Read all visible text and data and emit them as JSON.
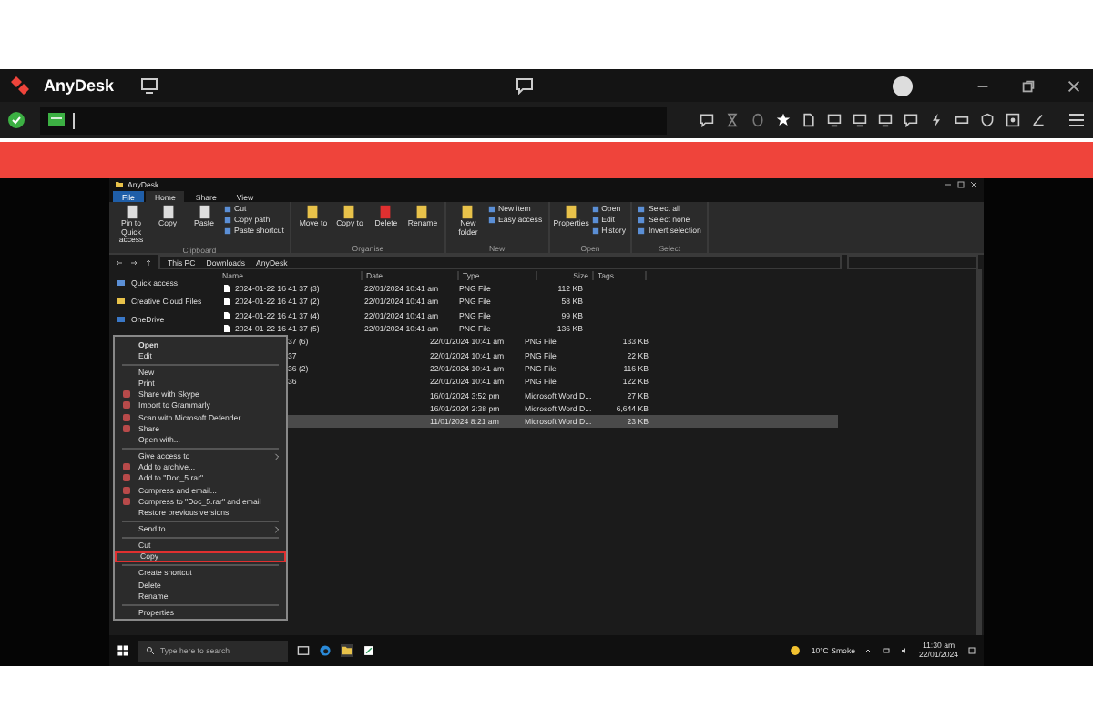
{
  "app": {
    "title": "AnyDesk"
  },
  "explorer": {
    "title": "AnyDesk",
    "ribbon_tabs": [
      {
        "label": "File",
        "selected": false
      },
      {
        "label": "Home",
        "selected": true
      },
      {
        "label": "Share",
        "selected": false
      },
      {
        "label": "View",
        "selected": false
      }
    ],
    "ribbon_groups": [
      {
        "name": "Clipboard",
        "buttons": [
          "Pin to Quick access",
          "Copy",
          "Paste"
        ],
        "small_buttons": [
          "Cut",
          "Copy path",
          "Paste shortcut"
        ]
      },
      {
        "name": "Organise",
        "buttons": [
          "Move to",
          "Copy to",
          "Delete",
          "Rename"
        ]
      },
      {
        "name": "New",
        "buttons": [
          "New folder"
        ],
        "small_buttons": [
          "New item",
          "Easy access"
        ]
      },
      {
        "name": "Open",
        "buttons": [
          "Properties"
        ],
        "small_buttons": [
          "Open",
          "Edit",
          "History"
        ]
      },
      {
        "name": "Select",
        "small_buttons": [
          "Select all",
          "Select none",
          "Invert selection"
        ]
      }
    ],
    "breadcrumb": [
      "This PC",
      "Downloads",
      "AnyDesk"
    ],
    "nav": [
      "Quick access",
      "Creative Cloud Files",
      "OneDrive"
    ],
    "columns": [
      "Name",
      "Date",
      "Type",
      "Size",
      "Tags"
    ],
    "rows": [
      {
        "name": "2024-01-22 16 41 37 (3)",
        "date": "22/01/2024 10:41 am",
        "type": "PNG File",
        "size": "112 KB",
        "selected": false,
        "covered": false
      },
      {
        "name": "2024-01-22 16 41 37 (2)",
        "date": "22/01/2024 10:41 am",
        "type": "PNG File",
        "size": "58 KB",
        "selected": false,
        "covered": false
      },
      {
        "name": "2024-01-22 16 41 37 (4)",
        "date": "22/01/2024 10:41 am",
        "type": "PNG File",
        "size": "99 KB",
        "selected": false,
        "covered": false
      },
      {
        "name": "2024-01-22 16 41 37 (5)",
        "date": "22/01/2024 10:41 am",
        "type": "PNG File",
        "size": "136 KB",
        "selected": false,
        "covered": false
      },
      {
        "name": "37 (6)",
        "date": "22/01/2024 10:41 am",
        "type": "PNG File",
        "size": "133 KB",
        "selected": false,
        "covered": true
      },
      {
        "name": "37",
        "date": "22/01/2024 10:41 am",
        "type": "PNG File",
        "size": "22 KB",
        "selected": false,
        "covered": true
      },
      {
        "name": "36 (2)",
        "date": "22/01/2024 10:41 am",
        "type": "PNG File",
        "size": "116 KB",
        "selected": false,
        "covered": true
      },
      {
        "name": "36",
        "date": "22/01/2024 10:41 am",
        "type": "PNG File",
        "size": "122 KB",
        "selected": false,
        "covered": true
      },
      {
        "date": "16/01/2024 3:52 pm",
        "type": "Microsoft Word D...",
        "size": "27 KB",
        "selected": false,
        "covered": true
      },
      {
        "date": "16/01/2024 2:38 pm",
        "type": "Microsoft Word D...",
        "size": "6,644 KB",
        "selected": false,
        "covered": true
      },
      {
        "date": "11/01/2024 8:21 am",
        "type": "Microsoft Word D...",
        "size": "23 KB",
        "selected": true,
        "covered": true
      }
    ],
    "context_menu": [
      {
        "label": "Open",
        "kind": "default",
        "highlighted": false
      },
      {
        "label": "Edit",
        "kind": "plain",
        "highlighted": false
      },
      {
        "kind": "separator"
      },
      {
        "label": "New",
        "kind": "plain",
        "highlighted": false
      },
      {
        "label": "Print",
        "kind": "plain",
        "highlighted": false
      },
      {
        "label": "Share with Skype",
        "kind": "icon",
        "highlighted": false
      },
      {
        "label": "Import to Grammarly",
        "kind": "icon",
        "highlighted": false
      },
      {
        "label": "Scan with Microsoft Defender...",
        "kind": "icon",
        "highlighted": false
      },
      {
        "label": "Share",
        "kind": "icon",
        "highlighted": false
      },
      {
        "label": "Open with...",
        "kind": "plain",
        "highlighted": false
      },
      {
        "kind": "separator"
      },
      {
        "label": "Give access to",
        "kind": "submenu",
        "highlighted": false
      },
      {
        "label": "Add to archive...",
        "kind": "icon",
        "highlighted": false
      },
      {
        "label": "Add to \"Doc_5.rar\"",
        "kind": "icon",
        "highlighted": false
      },
      {
        "label": "Compress and email...",
        "kind": "icon",
        "highlighted": false
      },
      {
        "label": "Compress to \"Doc_5.rar\" and email",
        "kind": "icon",
        "highlighted": false
      },
      {
        "label": "Restore previous versions",
        "kind": "plain",
        "highlighted": false
      },
      {
        "kind": "separator"
      },
      {
        "label": "Send to",
        "kind": "submenu",
        "highlighted": false
      },
      {
        "kind": "separator"
      },
      {
        "label": "Cut",
        "kind": "plain",
        "highlighted": false
      },
      {
        "label": "Copy",
        "kind": "plain",
        "highlighted": true
      },
      {
        "kind": "separator"
      },
      {
        "label": "Create shortcut",
        "kind": "plain",
        "highlighted": false
      },
      {
        "label": "Delete",
        "kind": "plain",
        "highlighted": false
      },
      {
        "label": "Rename",
        "kind": "plain",
        "highlighted": false
      },
      {
        "kind": "separator"
      },
      {
        "label": "Properties",
        "kind": "plain",
        "highlighted": false
      }
    ]
  },
  "taskbar": {
    "search_placeholder": "Type here to search",
    "weather": "10°C Smoke",
    "time": "11:30 am",
    "date": "22/01/2024"
  }
}
